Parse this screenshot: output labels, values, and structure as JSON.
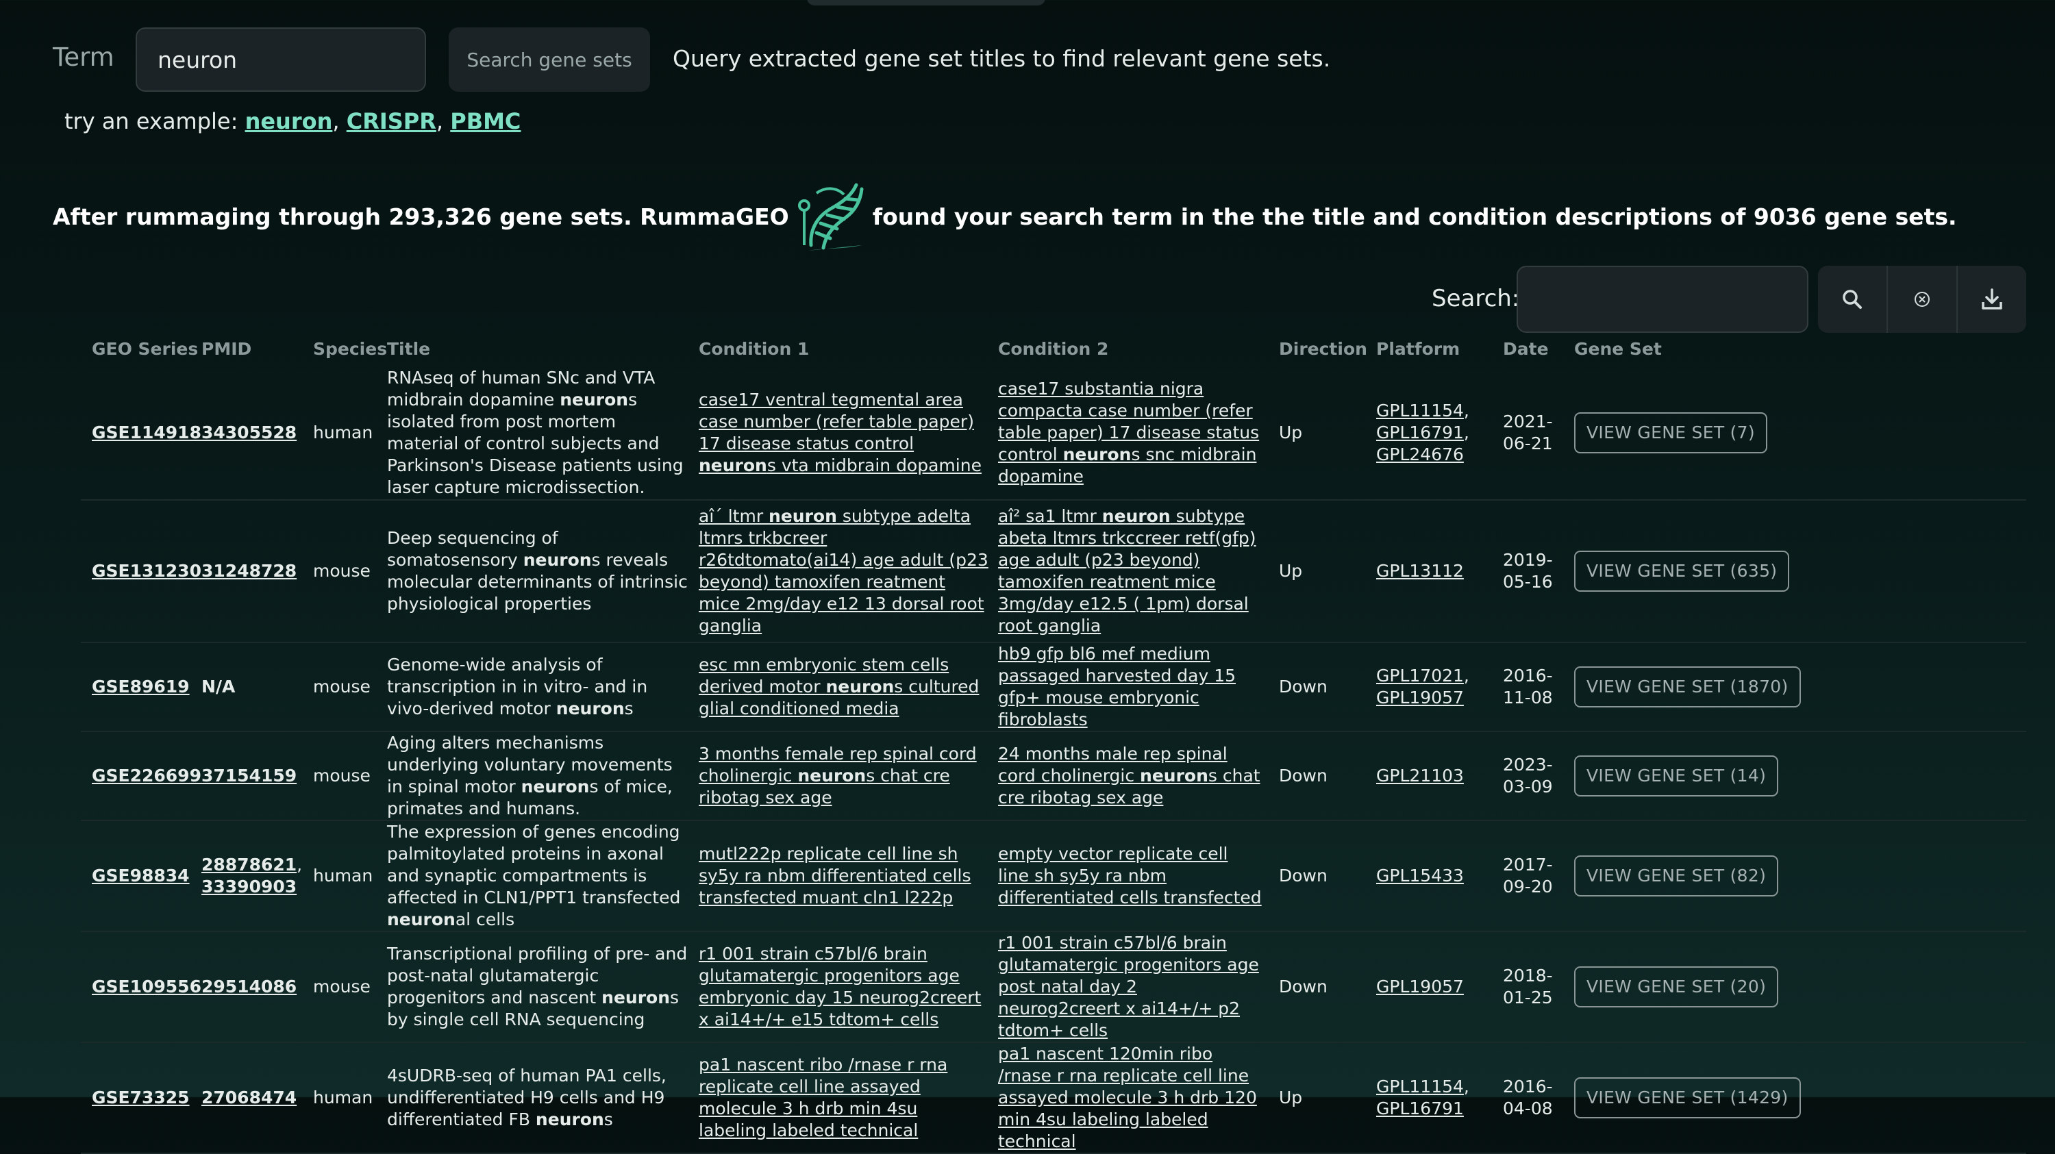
{
  "search": {
    "term_label": "Term",
    "term_value": "neuron",
    "button_label": "Search gene sets",
    "description": "Query extracted gene set titles to find relevant gene sets."
  },
  "examples": {
    "prefix": "try an example:",
    "items": [
      "neuron",
      "CRISPR",
      "PBMC"
    ]
  },
  "summary": {
    "before": "After rummaging through 293,326 gene sets. RummaGEO",
    "after": "found your search term in the the title and condition descriptions of 9036 gene sets."
  },
  "table_search": {
    "label": "Search:",
    "value": ""
  },
  "icons": {
    "search": "search-icon",
    "clear": "clear-circle-icon",
    "download": "download-icon",
    "logo": "rummageo-dna-logo"
  },
  "colors": {
    "accent": "#7fe0c5",
    "logo": "#49c39b",
    "background": "#081a19",
    "panel": "#1c2326"
  },
  "columns": [
    "GEO Series",
    "PMID",
    "Species",
    "Title",
    "Condition 1",
    "Condition 2",
    "Direction",
    "Platform",
    "Date",
    "Gene Set"
  ],
  "rows": [
    {
      "geo": "GSE114918",
      "pmid": [
        "34305528"
      ],
      "species": "human",
      "title": "RNAseq of human SNc and VTA midbrain dopamine **neuron**s isolated from post mortem material of control subjects and Parkinson's Disease patients using laser capture microdissection.",
      "cond1": "case17 ventral tegmental area case number (refer table paper) 17 disease status control **neuron**s vta midbrain dopamine",
      "cond2": "case17 substantia nigra compacta case number (refer table paper) 17 disease status control **neuron**s snc midbrain dopamine",
      "direction": "Up",
      "platform": [
        "GPL11154",
        "GPL16791",
        "GPL24676"
      ],
      "date": "2021-06-21",
      "gene_set": "VIEW GENE SET (7)"
    },
    {
      "geo": "GSE131230",
      "pmid": [
        "31248728"
      ],
      "species": "mouse",
      "title": "Deep sequencing of somatosensory **neuron**s reveals molecular determinants of intrinsic physiological properties",
      "cond1": "aî´ ltmr **neuron** subtype adelta ltmrs trkbcreer r26tdtomato(ai14) age adult (p23 beyond) tamoxifen reatment mice 2mg/day e12 13 dorsal root ganglia",
      "cond2": "aî² sa1 ltmr **neuron** subtype abeta ltmrs trkccreer retf(gfp) age adult (p23 beyond) tamoxifen reatment mice 3mg/day e12.5 ( 1pm) dorsal root ganglia",
      "direction": "Up",
      "platform": [
        "GPL13112"
      ],
      "date": "2019-05-16",
      "gene_set": "VIEW GENE SET (635)"
    },
    {
      "geo": "GSE89619",
      "pmid": [
        "N/A"
      ],
      "species": "mouse",
      "title": "Genome-wide analysis of transcription in in vitro- and in vivo-derived motor **neuron**s",
      "cond1": "esc mn embryonic stem cells derived motor **neuron**s cultured glial conditioned media",
      "cond2": "hb9 gfp bl6 mef medium passaged harvested day 15 gfp+ mouse embryonic fibroblasts",
      "direction": "Down",
      "platform": [
        "GPL17021",
        "GPL19057"
      ],
      "date": "2016-11-08",
      "gene_set": "VIEW GENE SET (1870)"
    },
    {
      "geo": "GSE226699",
      "pmid": [
        "37154159"
      ],
      "species": "mouse",
      "title": "Aging alters mechanisms underlying voluntary movements in spinal motor **neuron**s of mice, primates and humans.",
      "cond1": "3 months female rep spinal cord cholinergic **neuron**s chat cre ribotag sex age",
      "cond2": "24 months male rep spinal cord cholinergic **neuron**s chat cre ribotag sex age",
      "direction": "Down",
      "platform": [
        "GPL21103"
      ],
      "date": "2023-03-09",
      "gene_set": "VIEW GENE SET (14)"
    },
    {
      "geo": "GSE98834",
      "pmid": [
        "28878621",
        "33390903"
      ],
      "species": "human",
      "title": "The expression of genes encoding palmitoylated proteins in axonal and synaptic compartments is affected in CLN1/PPT1 transfected **neuron**al cells",
      "cond1": "mutl222p replicate cell line sh sy5y ra nbm differentiated cells transfected muant cln1 l222p",
      "cond2": "empty vector replicate cell line sh sy5y ra nbm differentiated cells transfected",
      "direction": "Down",
      "platform": [
        "GPL15433"
      ],
      "date": "2017-09-20",
      "gene_set": "VIEW GENE SET (82)"
    },
    {
      "geo": "GSE109556",
      "pmid": [
        "29514086"
      ],
      "species": "mouse",
      "title": "Transcriptional profiling of pre- and post-natal glutamatergic progenitors and nascent **neuron**s by single cell RNA sequencing",
      "cond1": "r1 001 strain c57bl/6 brain glutamatergic progenitors age embryonic day 15 neurog2creert x ai14+/+ e15 tdtom+ cells",
      "cond2": "r1 001 strain c57bl/6 brain glutamatergic progenitors age post natal day 2 neurog2creert x ai14+/+ p2 tdtom+ cells",
      "direction": "Down",
      "platform": [
        "GPL19057"
      ],
      "date": "2018-01-25",
      "gene_set": "VIEW GENE SET (20)"
    },
    {
      "geo": "GSE73325",
      "pmid": [
        "27068474"
      ],
      "species": "human",
      "title": "4sUDRB-seq of human PA1 cells, undifferentiated H9 cells and H9 differentiated FB **neuron**s",
      "cond1": "pa1 nascent ribo /rnase r rna replicate cell line assayed molecule 3 h drb min 4su labeling labeled technical",
      "cond2": "pa1 nascent 120min ribo /rnase r rna replicate cell line assayed molecule 3 h drb 120 min 4su labeling labeled technical",
      "direction": "Up",
      "platform": [
        "GPL11154",
        "GPL16791"
      ],
      "date": "2016-04-08",
      "gene_set": "VIEW GENE SET (1429)"
    }
  ]
}
